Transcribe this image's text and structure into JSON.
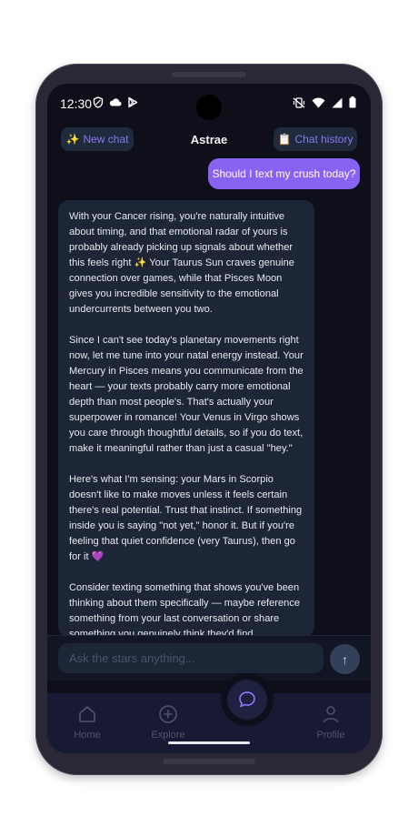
{
  "status_bar": {
    "time": "12:30"
  },
  "header": {
    "new_chat_emoji": "✨",
    "new_chat_label": "New chat",
    "title": "Astrae",
    "history_emoji": "📋",
    "history_label": "Chat history"
  },
  "chat": {
    "user_message": "Should I text my crush today?",
    "assistant_paragraphs": [
      "With your Cancer rising, you're naturally intuitive about timing, and that emotional radar of yours is probably already picking up signals about whether this feels right ✨ Your Taurus Sun craves genuine connection over games, while that Pisces Moon gives you incredible sensitivity to the emotional undercurrents between you two.",
      "Since I can't see today's planetary movements right now, let me tune into your natal energy instead. Your Mercury in Pisces means you communicate from the heart — your texts probably carry more emotional depth than most people's. That's actually your superpower in romance! Your Venus in Virgo shows you care through thoughtful details, so if you do text, make it meaningful rather than just a casual \"hey.\"",
      "Here's what I'm sensing: your Mars in Scorpio doesn't like to make moves unless it feels certain there's real potential. Trust that instinct. If something inside you is saying \"not yet,\" honor it. But if you're feeling that quiet confidence (very Taurus), then go for it 💜",
      "Consider texting something that shows you've been thinking about them specifically — maybe reference something from your last conversation or share something you genuinely think they'd find interesting. Your Virgo Venus appreciates authenticity over"
    ]
  },
  "input": {
    "placeholder": "Ask the stars anything...",
    "value": "",
    "send_glyph": "↑"
  },
  "nav": {
    "items": [
      {
        "label": "Home",
        "icon": "home-icon"
      },
      {
        "label": "Explore",
        "icon": "plus-circle-icon"
      },
      {
        "label": "",
        "icon": "chat-bubble-icon"
      },
      {
        "label": "Profile",
        "icon": "profile-icon"
      }
    ]
  },
  "colors": {
    "background": "#0f0e1b",
    "accent": "#8863f2",
    "bubble": "#1d2637",
    "nav_background": "#181a33"
  }
}
